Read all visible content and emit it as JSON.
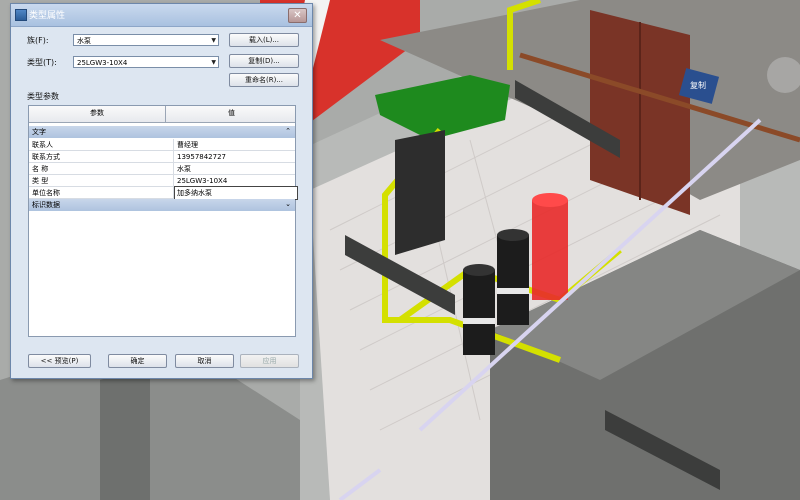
{
  "dialog": {
    "title": "类型属性",
    "close": "✕",
    "family_label": "族(F):",
    "family_value": "水泵",
    "type_label": "类型(T):",
    "type_value": "25LGW3-10X4",
    "buttons": {
      "load": "载入(L)...",
      "duplicate": "复制(D)...",
      "rename": "重命名(R)..."
    },
    "section_label": "类型参数",
    "grid": {
      "col_param": "参数",
      "col_value": "值",
      "group_text": "文字",
      "group_text_chev": "⌃",
      "rows": [
        {
          "k": "联系人",
          "v": "曹经理"
        },
        {
          "k": "联系方式",
          "v": "13957842727"
        },
        {
          "k": "名 称",
          "v": "水泵"
        },
        {
          "k": "类 型",
          "v": "25LGW3-10X4"
        },
        {
          "k": "单位名称",
          "v": "加多纳水泵"
        }
      ],
      "group_id": "标识数据",
      "group_id_chev": "⌄"
    },
    "footer": {
      "preview": "<< 预览(P)",
      "ok": "确定",
      "cancel": "取消",
      "apply": "应用"
    }
  },
  "scene": {
    "sign_text": "复制"
  }
}
